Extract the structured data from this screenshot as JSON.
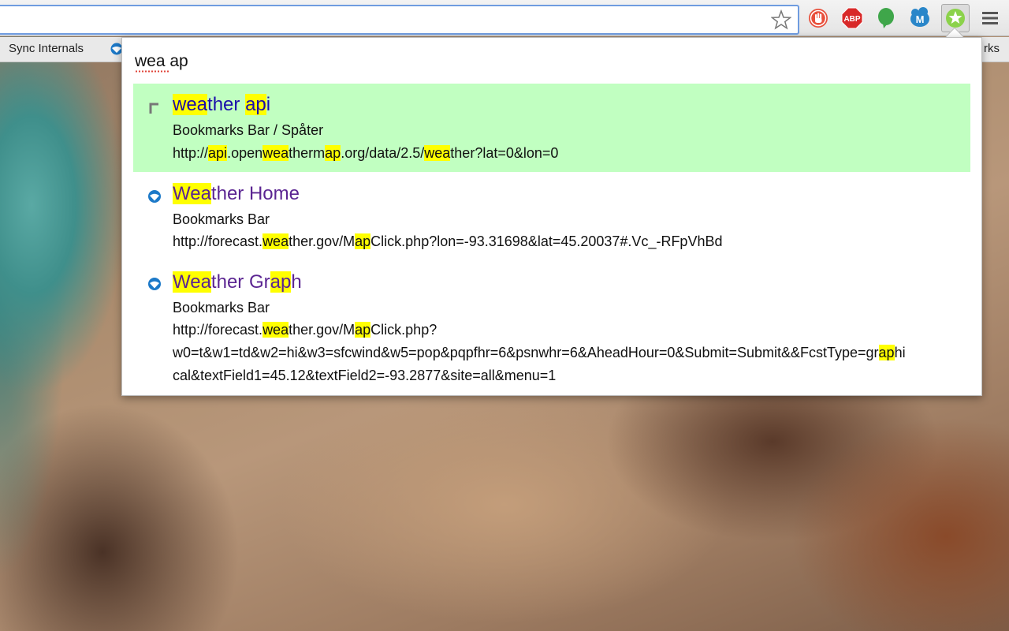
{
  "toolbar": {
    "omnibox_value": "",
    "extensions": [
      "stop-hand-icon",
      "adblock-plus-icon",
      "evernote-icon",
      "m-icon",
      "bookmark-star-icon"
    ],
    "abp_label": "ABP",
    "m_label": "M"
  },
  "bookmarks_bar": {
    "items": [
      "Sync Internals"
    ],
    "others_label": "rks"
  },
  "popup": {
    "query": "wea ap",
    "results": [
      {
        "title": [
          [
            "wea",
            true
          ],
          [
            "ther ",
            false
          ],
          [
            "ap",
            true
          ],
          [
            "i",
            false
          ]
        ],
        "folder": "Bookmarks Bar / Spåter",
        "url_lines": [
          [
            [
              "http://",
              false
            ],
            [
              "api",
              true
            ],
            [
              ".open",
              false
            ],
            [
              "wea",
              true
            ],
            [
              "therm",
              false
            ],
            [
              "ap",
              true
            ],
            [
              ".org/data/2.5/",
              false
            ],
            [
              "wea",
              true
            ],
            [
              "ther?lat=0&lon=0",
              false
            ]
          ]
        ],
        "selected": true
      },
      {
        "title": [
          [
            "Wea",
            true
          ],
          [
            "ther Home",
            false
          ]
        ],
        "folder": "Bookmarks Bar",
        "url_lines": [
          [
            [
              "http://forecast.",
              false
            ],
            [
              "wea",
              true
            ],
            [
              "ther.gov/M",
              false
            ],
            [
              "ap",
              true
            ],
            [
              "Click.php?lon=-93.31698&lat=45.20037#.Vc_-RFpVhBd",
              false
            ]
          ]
        ],
        "selected": false
      },
      {
        "title": [
          [
            "Wea",
            true
          ],
          [
            "ther Gr",
            false
          ],
          [
            "ap",
            true
          ],
          [
            "h",
            false
          ]
        ],
        "folder": "Bookmarks Bar",
        "url_lines": [
          [
            [
              "http://forecast.",
              false
            ],
            [
              "wea",
              true
            ],
            [
              "ther.gov/M",
              false
            ],
            [
              "ap",
              true
            ],
            [
              "Click.php?",
              false
            ]
          ],
          [
            [
              "w0=t&w1=td&w2=hi&w3=sfcwind&w5=pop&pqpfhr=6&psnwhr=6&AheadHour=0&Submit=Submit&&FcstType=gr",
              false
            ],
            [
              "ap",
              true
            ],
            [
              "hi",
              false
            ]
          ],
          [
            [
              "cal&textField1=45.12&textField2=-93.2877&site=all&menu=1",
              false
            ]
          ]
        ],
        "selected": false
      }
    ]
  },
  "colors": {
    "selected_bg": "#c1ffc1",
    "highlight": "#ffff00",
    "link_blue": "#1a0dab",
    "visited_purple": "#5b2592"
  }
}
